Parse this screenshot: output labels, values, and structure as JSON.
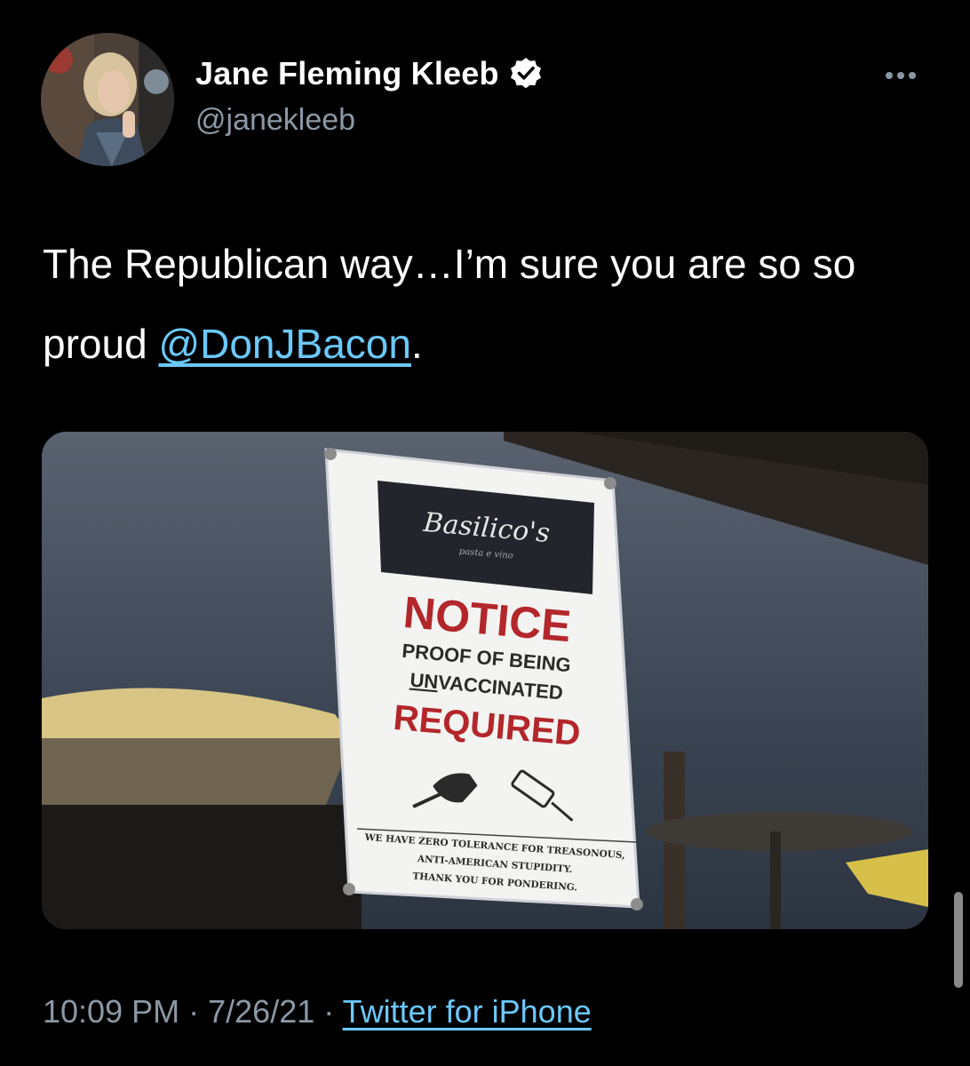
{
  "tweet": {
    "author": {
      "display_name": "Jane Fleming Kleeb",
      "handle": "@janekleeb",
      "verified": true
    },
    "text_before": "The Republican way…I’m sure you are so so proud ",
    "mention": "@DonJBacon",
    "text_after": ".",
    "time": "10:09 PM",
    "date": "7/26/21",
    "separator": "·",
    "source": "Twitter for iPhone"
  },
  "media_sign": {
    "logo": "Basilico's",
    "logo_sub": "pasta e vino",
    "heading": "NOTICE",
    "line1": "PROOF OF BEING",
    "line2_underlined": "UN",
    "line2_rest": "VACCINATED",
    "line3": "REQUIRED",
    "footer1": "WE HAVE ZERO TOLERANCE FOR TREASONOUS,",
    "footer2": "ANTI-AMERICAN STUPIDITY.",
    "footer3": "THANK YOU FOR PONDERING."
  },
  "colors": {
    "background": "#000000",
    "link": "#6bc9fb",
    "secondary_text": "#8b98a5",
    "notice_red": "#b3262a"
  },
  "icons": {
    "verified": "verified-badge-icon",
    "more": "more-horizontal-icon"
  }
}
